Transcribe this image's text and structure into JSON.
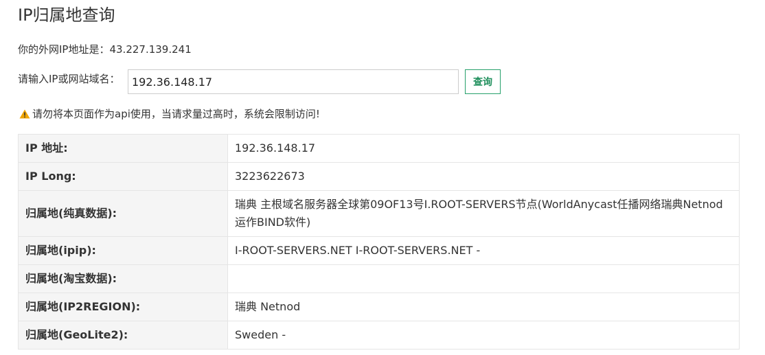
{
  "page": {
    "title": "IP归属地查询",
    "my_ip_text": "你的外网IP地址是：43.227.139.241"
  },
  "query": {
    "label": "请输入IP或网站域名：",
    "value": "192.36.148.17",
    "button": "查询"
  },
  "warning": {
    "icon": "warning-icon",
    "text": "请勿将本页面作为api使用，当请求量过高时，系统会限制访问!"
  },
  "results": [
    {
      "key": "IP 地址:",
      "value": "192.36.148.17"
    },
    {
      "key": "IP Long:",
      "value": "3223622673"
    },
    {
      "key": "归属地(纯真数据):",
      "value": "瑞典 主根域名服务器全球第09OF13号I.ROOT-SERVERS节点(WorldAnycast任播网络瑞典Netnod运作BIND软件)"
    },
    {
      "key": "归属地(ipip):",
      "value": "I-ROOT-SERVERS.NET I-ROOT-SERVERS.NET -"
    },
    {
      "key": "归属地(淘宝数据):",
      "value": ""
    },
    {
      "key": "归属地(IP2REGION):",
      "value": "瑞典 Netnod"
    },
    {
      "key": "归属地(GeoLite2):",
      "value": "Sweden -"
    }
  ],
  "colors": {
    "button_accent": "#1f8f5c",
    "warning_icon": "#f0a500",
    "key_cell_bg": "#f5f5f5"
  }
}
